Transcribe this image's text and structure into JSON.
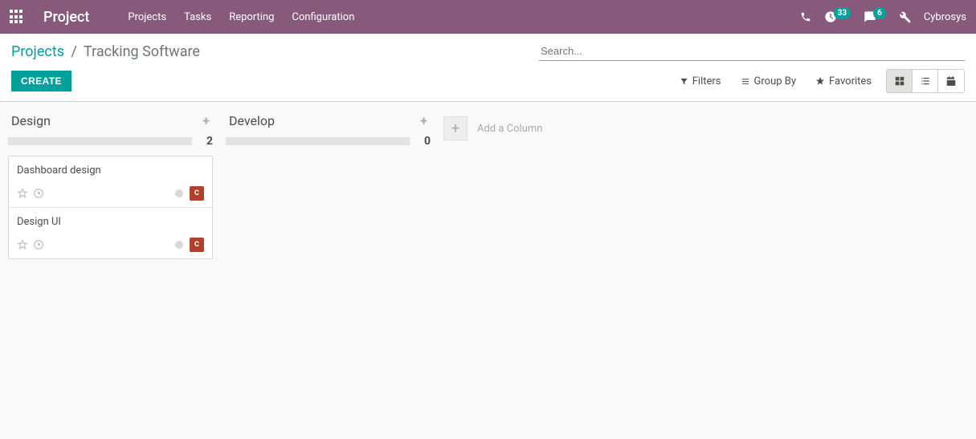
{
  "topnav": {
    "brand": "Project",
    "links": [
      "Projects",
      "Tasks",
      "Reporting",
      "Configuration"
    ],
    "timer_badge": "33",
    "messages_badge": "6",
    "username": "Cybrosys"
  },
  "breadcrumb": {
    "parent": "Projects",
    "current": "Tracking Software"
  },
  "search": {
    "placeholder": "Search..."
  },
  "buttons": {
    "create": "CREATE"
  },
  "search_options": {
    "filters": "Filters",
    "groupby": "Group By",
    "favorites": "Favorites"
  },
  "kanban": {
    "columns": [
      {
        "title": "Design",
        "count": "2",
        "cards": [
          {
            "title": "Dashboard design"
          },
          {
            "title": "Design UI"
          }
        ]
      },
      {
        "title": "Develop",
        "count": "0",
        "cards": []
      }
    ],
    "add_column": "Add a Column"
  }
}
